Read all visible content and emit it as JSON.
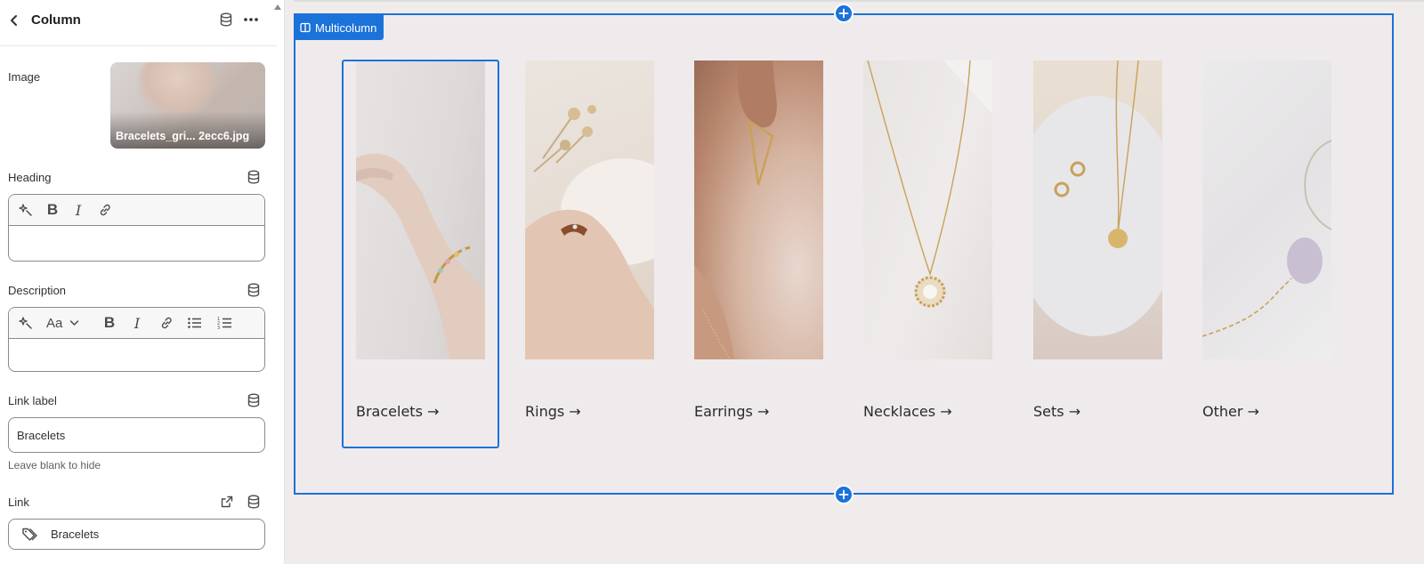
{
  "panel": {
    "title": "Column",
    "fields": {
      "image": {
        "label": "Image",
        "filename": "Bracelets_gri... 2ecc6.jpg"
      },
      "heading": {
        "label": "Heading",
        "value": ""
      },
      "description": {
        "label": "Description",
        "text_style": "Aa",
        "value": ""
      },
      "link_label": {
        "label": "Link label",
        "value": "Bracelets",
        "help": "Leave blank to hide"
      },
      "link": {
        "label": "Link",
        "value": "Bracelets"
      }
    }
  },
  "preview": {
    "section_name": "Multicolumn",
    "columns": [
      {
        "label": "Bracelets",
        "arrow": "→",
        "selected": true
      },
      {
        "label": "Rings",
        "arrow": "→"
      },
      {
        "label": "Earrings",
        "arrow": "→"
      },
      {
        "label": "Necklaces",
        "arrow": "→"
      },
      {
        "label": "Sets",
        "arrow": "→"
      },
      {
        "label": "Other",
        "arrow": "→"
      }
    ]
  },
  "colors": {
    "accent": "#1b72d9",
    "canvas": "#efebed",
    "panel_bg": "#ffffff"
  }
}
